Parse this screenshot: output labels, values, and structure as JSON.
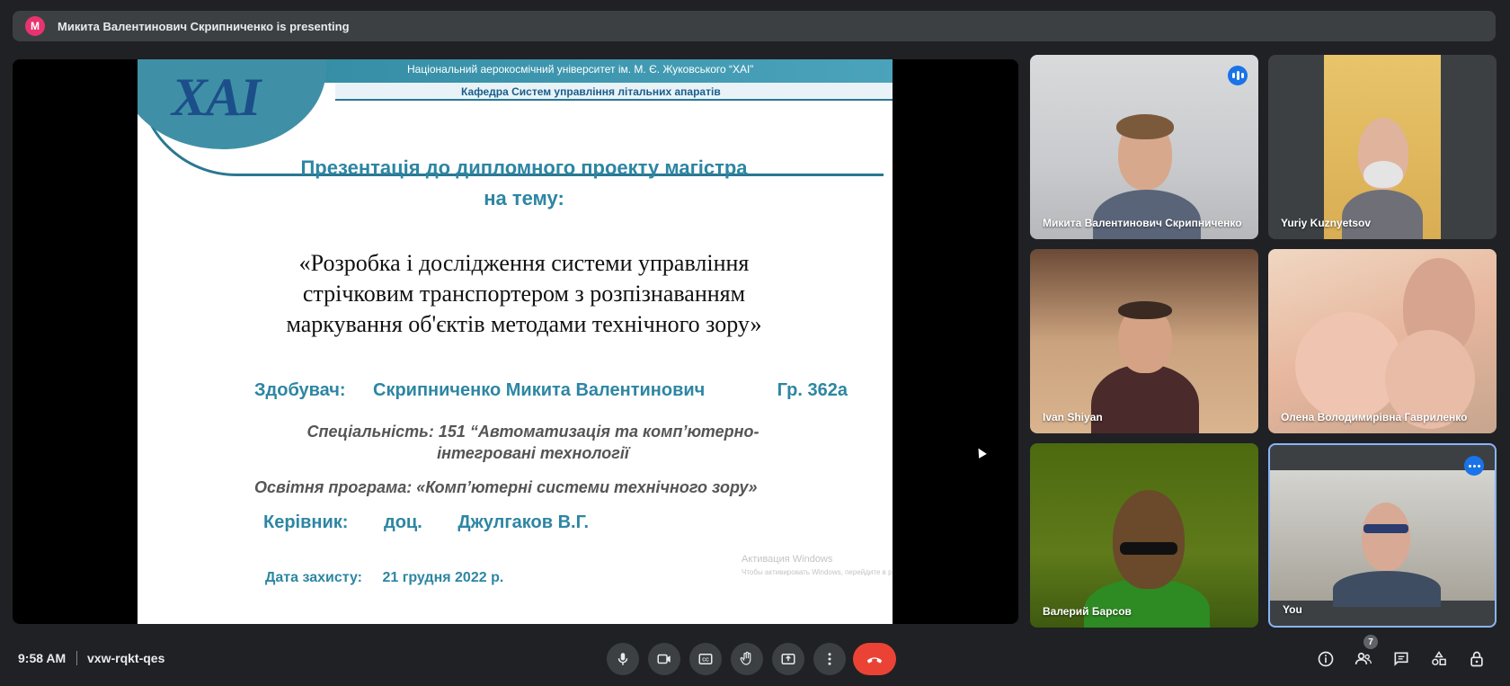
{
  "presenting": {
    "avatar_letter": "M",
    "avatar_color": "#e8336f",
    "text": "Микита Валентинович Скрипниченко is presenting"
  },
  "slide": {
    "logo_text": "ХАІ",
    "university": "Національний аерокосмічний університет ім. М. Є. Жуковського “ХАІ”",
    "department": "Кафедра Систем управління літальних апаратів",
    "title_line1": "Презентація до дипломного проекту магістра",
    "title_line2": "на тему:",
    "topic_line1": "«Розробка і дослідження системи управління",
    "topic_line2": "стрічковим транспортером з розпізнаванням",
    "topic_line3": "маркування об'єктів методами технічного зору»",
    "author_label": "Здобувач:",
    "author_name": "Скрипниченко Микита Валентинович",
    "author_group": "Гр. 362а",
    "specialty_line1": "Спеціальність: 151 “Автоматизація та комп’ютерно-",
    "specialty_line2": "інтегровані технології",
    "program": "Освітня програма: «Комп’ютерні системи технічного зору»",
    "advisor_label": "Керівник:",
    "advisor_title": "доц.",
    "advisor_name": "Джулгаков В.Г.",
    "date_label": "Дата захисту:",
    "date_value": "21 грудня 2022 р.",
    "watermark_title": "Активация Windows",
    "watermark_sub": "Чтобы активировать Windows, перейдите в раздел \"Параметры\"."
  },
  "participants": [
    {
      "name": "Микита Валентинович Скрипниченко",
      "speaking": true
    },
    {
      "name": "Yuriy Kuznyetsov"
    },
    {
      "name": "Ivan Shiyan"
    },
    {
      "name": "Олена Володимирівна Гавриленко"
    },
    {
      "name": "Валерий Барсов"
    },
    {
      "name": "You",
      "self": true
    }
  ],
  "toolbar": {
    "time": "9:58 AM",
    "meeting_code": "vxw-rqkt-qes",
    "people_count": "7",
    "buttons": [
      "mic-icon",
      "camera-icon",
      "captions-icon",
      "raise-hand-icon",
      "present-icon",
      "more-options-icon",
      "hangup-icon"
    ],
    "right_icons": [
      "info-icon",
      "people-icon",
      "chat-icon",
      "activities-icon",
      "host-controls-icon"
    ]
  },
  "colors": {
    "background": "#202124",
    "bar": "#3c4043",
    "accent_blue": "#1a73e8",
    "hangup_red": "#ea4335",
    "slide_teal": "#2d86a3"
  }
}
